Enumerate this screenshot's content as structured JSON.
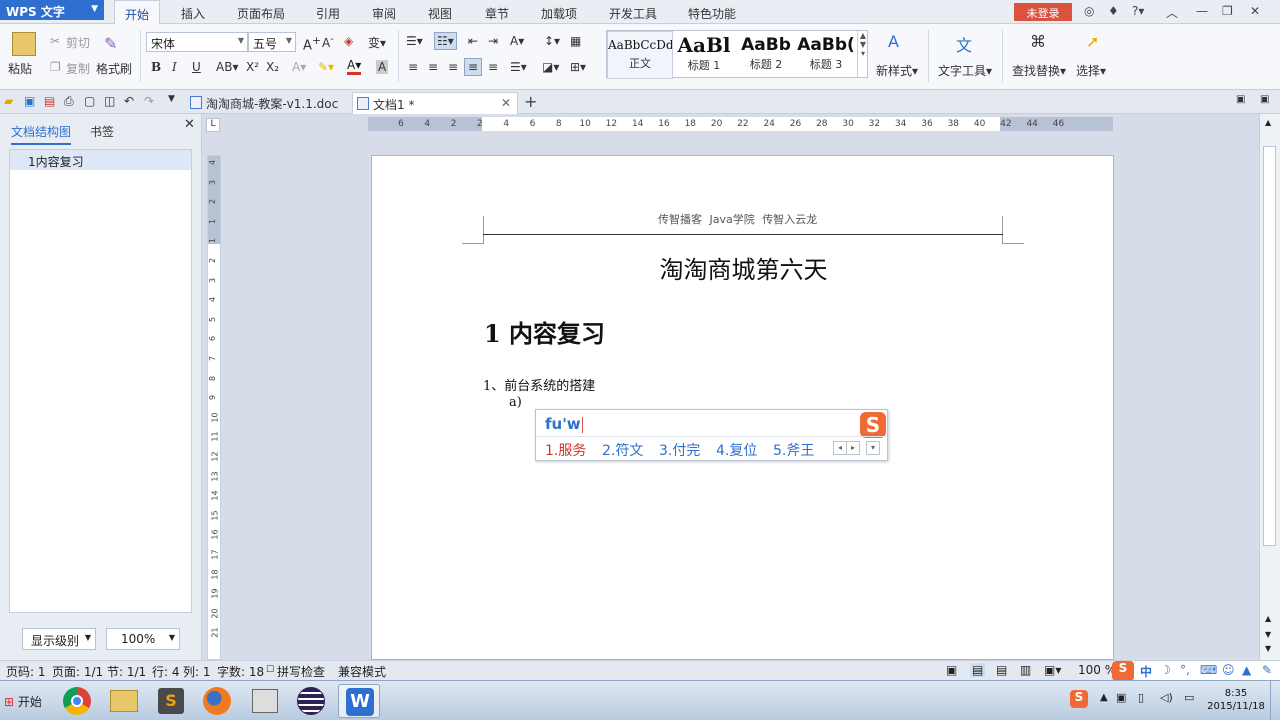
{
  "app": {
    "name": "WPS 文字",
    "menu_tabs": [
      "开始",
      "插入",
      "页面布局",
      "引用",
      "审阅",
      "视图",
      "章节",
      "加载项",
      "开发工具",
      "特色功能"
    ],
    "login_label": "未登录",
    "accent": "#2f6fcf",
    "login_color": "#d9533f"
  },
  "ribbon": {
    "paste": "粘贴",
    "cut": "剪切",
    "copy": "复制",
    "format_painter": "格式刷",
    "font_name": "宋体",
    "font_size": "五号",
    "bold": "B",
    "italic": "I",
    "underline": "U",
    "styles": [
      {
        "sample": "AaBbCcDd",
        "name": "正文"
      },
      {
        "sample": "AaBl",
        "name": "标题 1"
      },
      {
        "sample": "AaBb",
        "name": "标题 2"
      },
      {
        "sample": "AaBb(",
        "name": "标题 3"
      }
    ],
    "new_style": "新样式",
    "text_tools": "文字工具",
    "find_replace": "查找替换",
    "select": "选择"
  },
  "doc_tabs": [
    {
      "title": "淘淘商城-教案-v1.1.doc"
    },
    {
      "title": "文档1 *"
    }
  ],
  "left_panel": {
    "tab_outline": "文档结构图",
    "tab_bookmark": "书签",
    "tree_item": "1内容复习",
    "level_label": "显示级别",
    "zoom": "100%"
  },
  "ruler": {
    "h_ticks": [
      "6",
      "4",
      "2",
      "2",
      "4",
      "6",
      "8",
      "10",
      "12",
      "14",
      "16",
      "18",
      "20",
      "22",
      "24",
      "26",
      "28",
      "30",
      "32",
      "34",
      "36",
      "38",
      "40",
      "42",
      "44",
      "46"
    ],
    "v_ticks": [
      "4",
      "3",
      "2",
      "1",
      "1",
      "2",
      "3",
      "4",
      "5",
      "6",
      "7",
      "8",
      "9",
      "10",
      "11",
      "12",
      "13",
      "14",
      "15",
      "16",
      "17",
      "18",
      "19",
      "20",
      "21"
    ]
  },
  "document": {
    "header": "传智播客 Java学院 传智入云龙",
    "title": "淘淘商城第六天",
    "heading": "1  内容复习",
    "list_item": "1、前台系统的搭建",
    "sub_item": "a)"
  },
  "ime": {
    "input": "fu'w",
    "logo": "S",
    "candidates": [
      "1.服务",
      "2.符文",
      "3.付完",
      "4.复位",
      "5.斧王"
    ]
  },
  "status": {
    "page": "页码: 1",
    "pages": "页面: 1/1",
    "section": "节: 1/1",
    "row": "行: 4",
    "col": "列: 1",
    "words": "字数: 18",
    "spell": "拼写检查",
    "compat": "兼容模式",
    "zoom": "100 %"
  },
  "taskbar": {
    "start": "开始",
    "time": "8:35",
    "date": "2015/11/18"
  }
}
